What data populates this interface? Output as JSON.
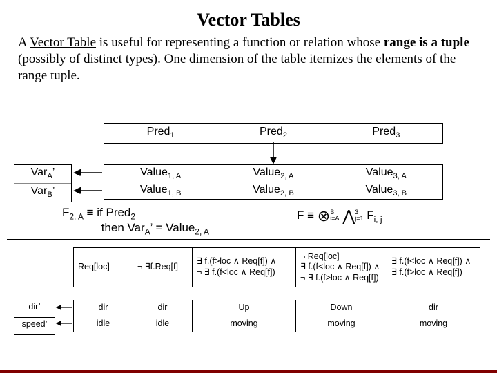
{
  "title": "Vector Tables",
  "body": {
    "t1": "A ",
    "t2": "Vector Table",
    "t3": " is useful for representing a function or relation whose ",
    "t4": "range is a tuple",
    "t5": " (possibly of distinct types).  One dimension of the table itemizes the elements of the range tuple."
  },
  "upper": {
    "pred": {
      "p1": "Pred",
      "s1": "1",
      "p2": "Pred",
      "s2": "2",
      "p3": "Pred",
      "s3": "3"
    },
    "var": {
      "va": "Var",
      "sa": "A",
      "ap": "’",
      "vb": "Var",
      "sb": "B",
      "bp": "’"
    },
    "val": {
      "v11": "Value",
      "s11": "1, A",
      "v12": "Value",
      "s12": "2, A",
      "v13": "Value",
      "s13": "3, A",
      "v21": "Value",
      "s21": "1, B",
      "v22": "Value",
      "s22": "2, B",
      "v23": "Value",
      "s23": "3, B"
    }
  },
  "formula_left": {
    "a": "F",
    "asub1": "2, A",
    "b": " ≡ if Pred",
    "bsub": "2",
    "c": "then Var",
    "csub": "A",
    "cp": "’ = Value",
    "csub2": "2, A"
  },
  "formula_right": {
    "a": "F  ≡ ",
    "up1": "B",
    "lo1": "i=A",
    "up2": "3",
    "lo2": "j=1",
    "t": "F",
    "tsub": "i, j"
  },
  "lower": {
    "pred": {
      "c1": {
        "l1": "Req[loc]"
      },
      "c2": {
        "l1": "¬ ∃f.Req[f]"
      },
      "c3": {
        "l1": "∃ f.(f>loc ∧ Req[f]) ∧",
        "l2": "¬ ∃ f.(f<loc ∧ Req[f])"
      },
      "c4": {
        "l1": "¬ Req[loc]",
        "l2": "∃ f.(f<loc ∧ Req[f]) ∧",
        "l3": "¬ ∃ f.(f>loc ∧ Req[f])"
      },
      "c5": {
        "l1": "∃ f.(f<loc ∧ Req[f]) ∧",
        "l2": "∃ f.(f>loc ∧ Req[f])"
      }
    },
    "var": {
      "v1": "dir’",
      "v2": "speed’"
    },
    "val": {
      "r1": {
        "c1": "dir",
        "c2": "dir",
        "c3": "Up",
        "c4": "Down",
        "c5": "dir"
      },
      "r2": {
        "c1": "idle",
        "c2": "idle",
        "c3": "moving",
        "c4": "moving",
        "c5": "moving"
      }
    }
  }
}
